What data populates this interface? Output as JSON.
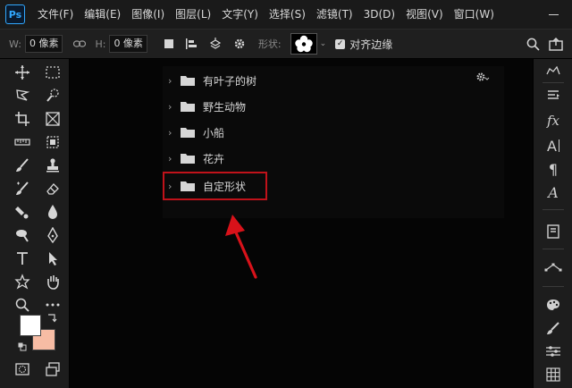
{
  "app": {
    "logo": "Ps"
  },
  "menu": [
    "文件(F)",
    "编辑(E)",
    "图像(I)",
    "图层(L)",
    "文字(Y)",
    "选择(S)",
    "滤镜(T)",
    "3D(D)",
    "视图(V)",
    "窗口(W)"
  ],
  "options": {
    "width_label": "W:",
    "width_value": "0 像素",
    "height_label": "H:",
    "height_value": "0 像素",
    "shape_label": "形状:",
    "align_edges_label": "对齐边缘",
    "align_edges_checked": true
  },
  "shape_panel": {
    "folders": [
      {
        "label": "有叶子的树"
      },
      {
        "label": "野生动物"
      },
      {
        "label": "小船"
      },
      {
        "label": "花卉"
      },
      {
        "label": "自定形状"
      }
    ],
    "highlighted_folder": "自定形状"
  },
  "colors": {
    "foreground": "#ffffff",
    "background": "#f7bca4",
    "highlight": "#c0121a",
    "accent": "#31a8ff"
  },
  "dock": {
    "char_label": "A"
  }
}
